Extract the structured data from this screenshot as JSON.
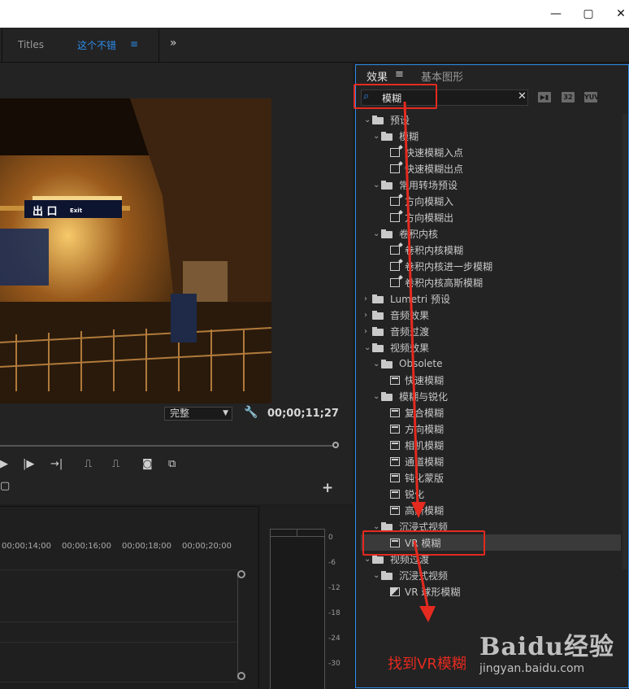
{
  "workspace": {
    "tab_titles": "Titles",
    "tab_active": "这个不错",
    "menu_icon": "≡",
    "overflow_icon": "»"
  },
  "monitor": {
    "resolution": "完整",
    "timecode": "00;00;11;27",
    "sign_text": "出 口",
    "sign_exit": "Exit"
  },
  "timeline": {
    "ticks": [
      "00;00;14;00",
      "00;00;16;00",
      "00;00;18;00",
      "00;00;20;00"
    ]
  },
  "meter": {
    "ticks": [
      "0",
      "-6",
      "-12",
      "-18",
      "-24",
      "-30"
    ]
  },
  "effects": {
    "tab_effects": "效果",
    "tab_menu": "≡",
    "tab_graphics": "基本图形",
    "search_value": "模糊",
    "filter_32": "32",
    "filter_yuv": "YUV",
    "items": [
      {
        "label": "预设",
        "type": "folder",
        "level": 0,
        "open": true
      },
      {
        "label": "模糊",
        "type": "folder",
        "level": 1,
        "open": true
      },
      {
        "label": "快速模糊入点",
        "type": "preset",
        "level": 2
      },
      {
        "label": "快速模糊出点",
        "type": "preset",
        "level": 2
      },
      {
        "label": "常用转场预设",
        "type": "folder",
        "level": 1,
        "open": true
      },
      {
        "label": "方向模糊入",
        "type": "preset",
        "level": 2
      },
      {
        "label": "方向模糊出",
        "type": "preset",
        "level": 2
      },
      {
        "label": "卷积内核",
        "type": "folder",
        "level": 1,
        "open": true
      },
      {
        "label": "卷积内核模糊",
        "type": "preset",
        "level": 2
      },
      {
        "label": "卷积内核进一步模糊",
        "type": "preset",
        "level": 2
      },
      {
        "label": "卷积内核高斯模糊",
        "type": "preset",
        "level": 2
      },
      {
        "label": "Lumetri 预设",
        "type": "folder",
        "level": 0,
        "open": false
      },
      {
        "label": "音频效果",
        "type": "folder",
        "level": 0,
        "open": false
      },
      {
        "label": "音频过渡",
        "type": "folder",
        "level": 0,
        "open": false
      },
      {
        "label": "视频效果",
        "type": "folder",
        "level": 0,
        "open": true
      },
      {
        "label": "Obsolete",
        "type": "folder",
        "level": 1,
        "open": true
      },
      {
        "label": "快速模糊",
        "type": "effect",
        "level": 2
      },
      {
        "label": "模糊与锐化",
        "type": "folder",
        "level": 1,
        "open": true
      },
      {
        "label": "复合模糊",
        "type": "effect",
        "level": 2
      },
      {
        "label": "方向模糊",
        "type": "effect",
        "level": 2
      },
      {
        "label": "相机模糊",
        "type": "effect",
        "level": 2
      },
      {
        "label": "通道模糊",
        "type": "effect",
        "level": 2
      },
      {
        "label": "钝化蒙版",
        "type": "effect",
        "level": 2
      },
      {
        "label": "锐化",
        "type": "effect",
        "level": 2
      },
      {
        "label": "高斯模糊",
        "type": "effect",
        "level": 2
      },
      {
        "label": "沉浸式视频",
        "type": "folder",
        "level": 1,
        "open": true
      },
      {
        "label": "VR 模糊",
        "type": "effect",
        "level": 2,
        "selected": true
      },
      {
        "label": "视频过渡",
        "type": "folder",
        "level": 0,
        "open": true
      },
      {
        "label": "沉浸式视频",
        "type": "folder",
        "level": 1,
        "open": true
      },
      {
        "label": "VR 球形模糊",
        "type": "transition",
        "level": 2
      }
    ]
  },
  "annotation": {
    "caption": "找到VR模糊",
    "color": "#e52a1f"
  },
  "watermark": {
    "brand": "Baidu经验",
    "url": "jingyan.baidu.com"
  },
  "colors": {
    "accent": "#2d8ceb",
    "panel": "#232323",
    "annotation": "#e52a1f"
  }
}
